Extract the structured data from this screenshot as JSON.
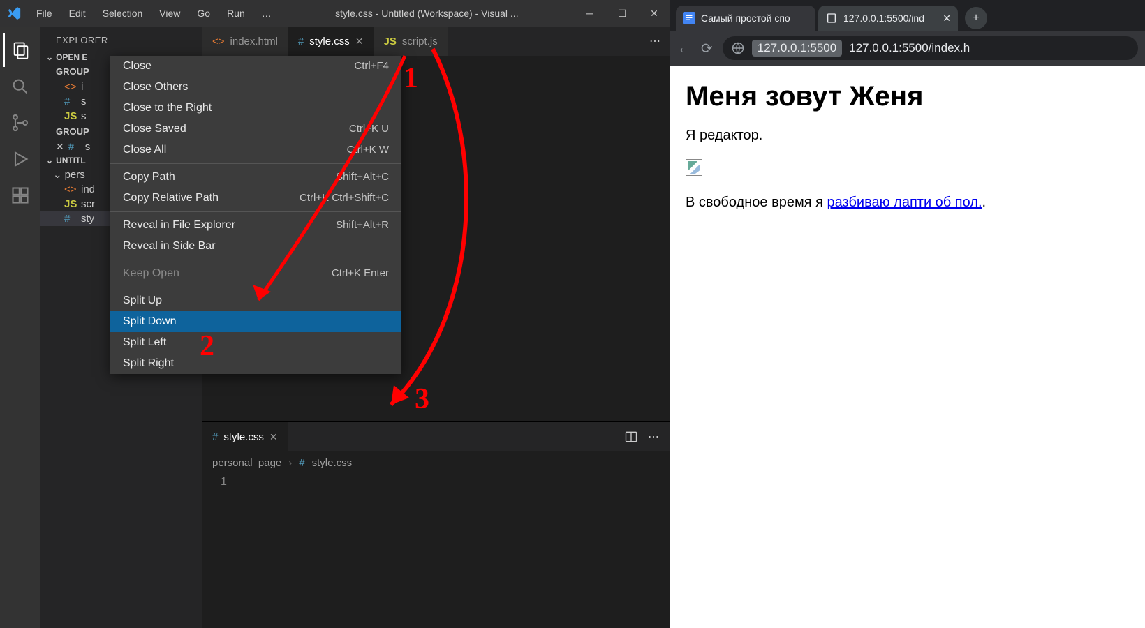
{
  "vscode": {
    "menus": [
      "File",
      "Edit",
      "Selection",
      "View",
      "Go",
      "Run",
      "…"
    ],
    "title": "style.css - Untitled (Workspace) - Visual ...",
    "explorer_label": "EXPLORER",
    "open_editors_label": "OPEN E",
    "group1_label": "GROUP",
    "group1_files": [
      {
        "icon": "html",
        "name": "i"
      },
      {
        "icon": "css",
        "name": "s"
      },
      {
        "icon": "js",
        "name": "s"
      }
    ],
    "group2_label": "GROUP",
    "group2_files": [
      {
        "icon": "css",
        "name": "s",
        "close": true
      }
    ],
    "workspace_label": "UNTITL",
    "folder_label": "pers",
    "ws_files": [
      {
        "icon": "html",
        "name": "ind"
      },
      {
        "icon": "js",
        "name": "scr"
      },
      {
        "icon": "css",
        "name": "sty"
      }
    ],
    "tabs": [
      {
        "icon": "html",
        "label": "index.html",
        "active": false
      },
      {
        "icon": "css",
        "label": "style.css",
        "active": true,
        "close": true
      },
      {
        "icon": "js",
        "label": "script.js",
        "active": false
      }
    ],
    "pane2": {
      "tab_label": "style.css",
      "breadcrumb_folder": "personal_page",
      "breadcrumb_file": "style.css",
      "line_number": "1"
    }
  },
  "context_menu": {
    "items": [
      {
        "label": "Close",
        "shortcut": "Ctrl+F4"
      },
      {
        "label": "Close Others"
      },
      {
        "label": "Close to the Right"
      },
      {
        "label": "Close Saved",
        "shortcut": "Ctrl+K U"
      },
      {
        "label": "Close All",
        "shortcut": "Ctrl+K W"
      },
      {
        "sep": true
      },
      {
        "label": "Copy Path",
        "shortcut": "Shift+Alt+C"
      },
      {
        "label": "Copy Relative Path",
        "shortcut": "Ctrl+K Ctrl+Shift+C"
      },
      {
        "sep": true
      },
      {
        "label": "Reveal in File Explorer",
        "shortcut": "Shift+Alt+R"
      },
      {
        "label": "Reveal in Side Bar"
      },
      {
        "sep": true
      },
      {
        "label": "Keep Open",
        "shortcut": "Ctrl+K Enter",
        "disabled": true
      },
      {
        "sep": true
      },
      {
        "label": "Split Up"
      },
      {
        "label": "Split Down",
        "hover": true
      },
      {
        "label": "Split Left"
      },
      {
        "label": "Split Right"
      }
    ]
  },
  "browser": {
    "tabs": [
      {
        "favicon": "docs",
        "label": "Самый простой спо"
      },
      {
        "favicon": "page",
        "label": "127.0.0.1:5500/ind",
        "active": true,
        "close": true
      }
    ],
    "address_host": "127.0.0.1:5500",
    "address_path": "127.0.0.1:5500/index.h",
    "page": {
      "h1": "Меня зовут Женя",
      "p1": "Я редактор.",
      "p2_prefix": "В свободное время я ",
      "p2_link": "разбиваю лапти об пол.",
      "p2_suffix": "."
    }
  },
  "annotations": {
    "n1": "1",
    "n2": "2",
    "n3": "3"
  }
}
